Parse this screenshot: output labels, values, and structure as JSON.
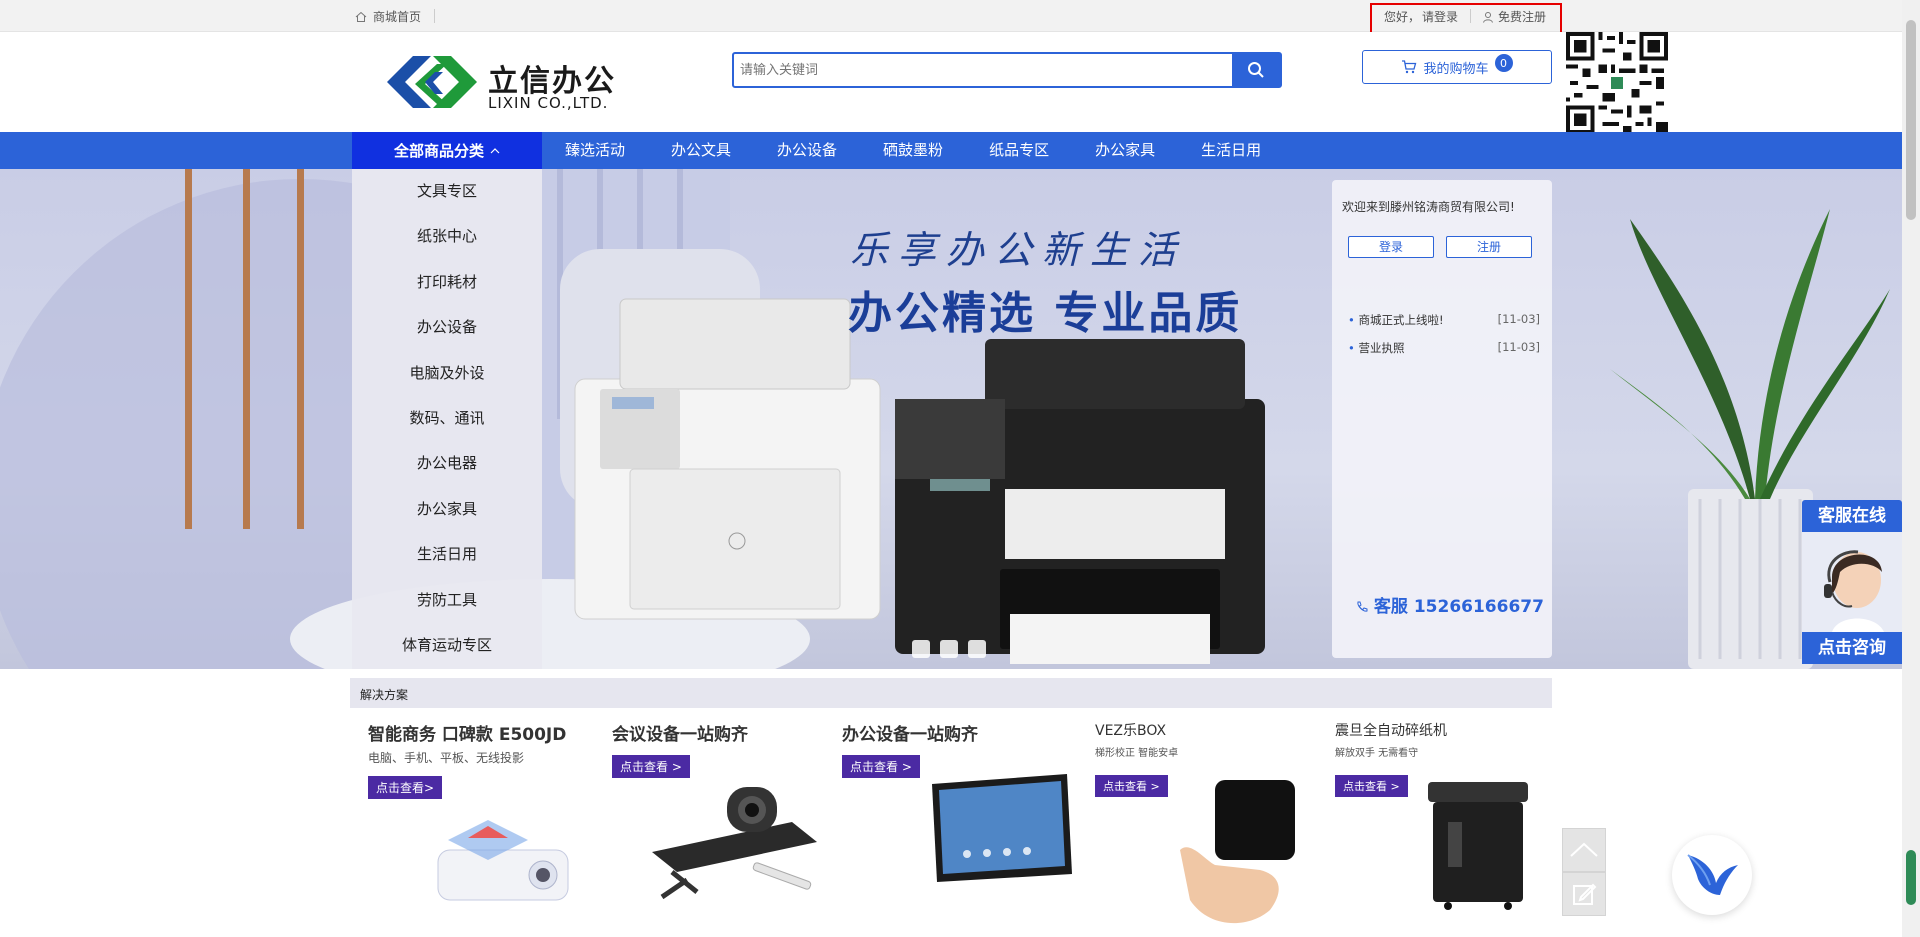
{
  "topbar": {
    "home_label": "商城首页",
    "greeting": "您好，",
    "login_label": "请登录",
    "register_label": "免费注册"
  },
  "header": {
    "logo_cn": "立信办公",
    "logo_en": "LIXIN CO.,LTD.",
    "search_placeholder": "请输入关键词",
    "cart_label": "我的购物车",
    "cart_count": "0"
  },
  "nav": {
    "all_categories": "全部商品分类",
    "items": [
      "臻选活动",
      "办公文具",
      "办公设备",
      "硒鼓墨粉",
      "纸品专区",
      "办公家具",
      "生活日用"
    ]
  },
  "categories": [
    "文具专区",
    "纸张中心",
    "打印耗材",
    "办公设备",
    "电脑及外设",
    "数码、通讯",
    "办公电器",
    "办公家具",
    "生活日用",
    "劳防工具",
    "体育运动专区"
  ],
  "banner": {
    "slogan": "乐享办公新生活",
    "headline": "办公精选 专业品质"
  },
  "welcome": {
    "text": "欢迎来到滕州铭涛商贸有限公司!",
    "login_button": "登录",
    "register_button": "注册",
    "news": [
      {
        "title": "商城正式上线啦!",
        "date": "[11-03]"
      },
      {
        "title": "营业执照",
        "date": "[11-03]"
      }
    ],
    "phone": "客服 15266166677"
  },
  "service": {
    "top": "客服在线",
    "bottom": "点击咨询"
  },
  "solutions": {
    "title": "解决方案"
  },
  "products": [
    {
      "title": "智能商务 口碑款 E500JD",
      "subtitle": "电脑、手机、平板、无线投影",
      "button": "点击查看>"
    },
    {
      "title": "会议设备一站购齐",
      "subtitle": "",
      "button": "点击查看 >"
    },
    {
      "title": "办公设备一站购齐",
      "subtitle": "",
      "button": "点击查看 >"
    },
    {
      "title": "VEZ乐BOX",
      "subtitle": "梯形校正 智能安卓",
      "button": "点击查看 >"
    },
    {
      "title": "震旦全自动碎纸机",
      "subtitle": "解放双手 无需看守",
      "button": "点击查看 >"
    }
  ],
  "colors": {
    "brand_blue": "#2c63d8",
    "all_categories_bg": "#1030e0",
    "product_button": "#4b2aa3",
    "logo_blue": "#1b4fa8",
    "logo_green": "#1f9a3a"
  }
}
